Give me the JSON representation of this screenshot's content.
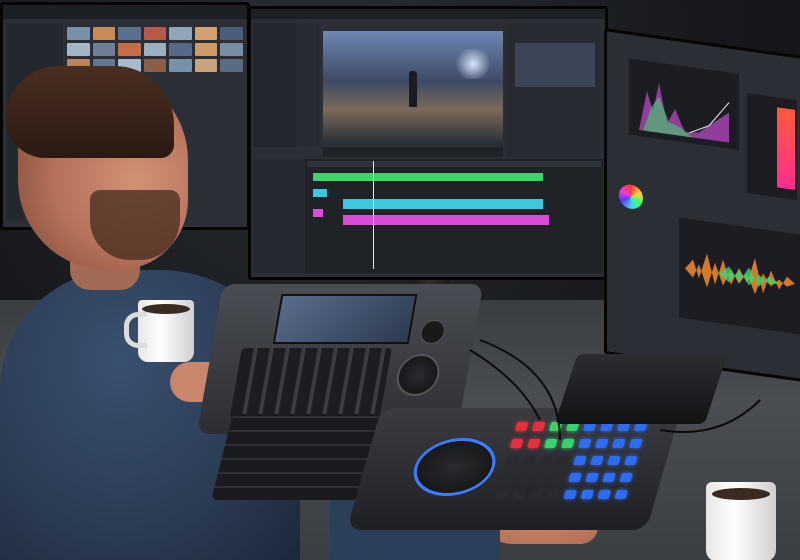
{
  "scene": {
    "subject": "video-editing-workstation",
    "palette": {
      "background": "#15171b",
      "desk": "#45484d",
      "monitor_frame": "#0b0c0e",
      "ui_panel": "#2b2e34",
      "timeline_green": "#3fd36b",
      "timeline_cyan": "#3ec8e0",
      "timeline_magenta": "#d94cd8",
      "waveform_orange": "#f28a2e",
      "button_red": "#e8303a",
      "button_green": "#36d46a",
      "button_blue": "#2c6df2",
      "ring_blue": "#3d7cff",
      "shirt": "#2f4560",
      "skin": "#c9866a",
      "hair": "#3a2418"
    }
  },
  "thumbnails": {
    "colors": [
      "#7b8fa8",
      "#c98b55",
      "#5a6f8c",
      "#b75a4a",
      "#8fa7b8",
      "#d2a070",
      "#4b5d78",
      "#a4b6c6",
      "#6d7f95",
      "#c46e48",
      "#9db0c0",
      "#556a86",
      "#cf9a64",
      "#7a8ea3",
      "#b8845a",
      "#62788f",
      "#a9bccb",
      "#8b5e4a",
      "#7890a8",
      "#c7a27a",
      "#5b6c80"
    ]
  }
}
